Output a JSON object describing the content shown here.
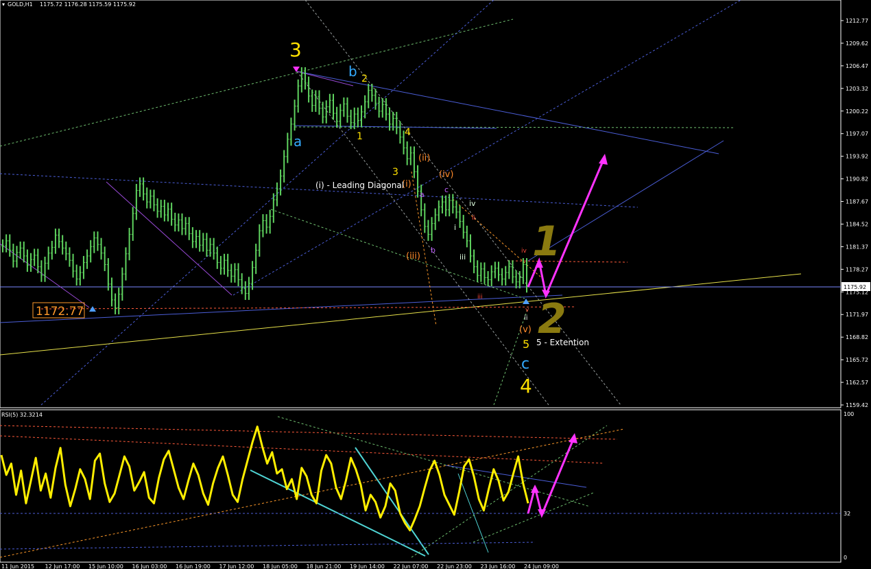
{
  "header": {
    "symbol": "GOLD,H1",
    "ohlc": "1175.72 1176.28 1175.59 1175.92"
  },
  "rsi": {
    "label": "RSI(5) 32.3214",
    "levels": [
      "100",
      "32",
      "0"
    ]
  },
  "price_axis": {
    "labels": [
      "1212.77",
      "1209.62",
      "1206.47",
      "1203.32",
      "1200.22",
      "1197.07",
      "1193.92",
      "1190.82",
      "1187.67",
      "1184.52",
      "1181.37",
      "1178.27",
      "1175.12",
      "1171.97",
      "1168.82",
      "1165.72",
      "1162.57",
      "1159.42"
    ],
    "current": "1175.92"
  },
  "time_axis": {
    "labels": [
      "11 Jun 2015",
      "12 Jun 17:00",
      "15 Jun 10:00",
      "16 Jun 03:00",
      "16 Jun 19:00",
      "17 Jun 12:00",
      "18 Jun 05:00",
      "18 Jun 21:00",
      "19 Jun 14:00",
      "22 Jun 07:00",
      "22 Jun 23:00",
      "23 Jun 16:00",
      "24 Jun 09:00"
    ]
  },
  "low_box": "1172.77",
  "annotations": {
    "wave3_major": "3",
    "wave4_major": "4",
    "wave_a": "a",
    "wave_b": "b",
    "wave_c": "c",
    "y1": "1",
    "y2": "2",
    "y3": "3",
    "y4": "4",
    "y5": "5",
    "o_i": "(i)",
    "o_ii": "(ii)",
    "o_iii": "(iii)",
    "o_iv": "(iv)",
    "o_v": "(v)",
    "leading_diagonal": "(i) - Leading Diagonal",
    "extension": "5 - Extention",
    "p_a": "a",
    "p_b": "b",
    "p_c": "c",
    "w_i": "i",
    "w_ii": "ii",
    "w_iii": "iii",
    "w_iv": "iv",
    "r_ii": "ii",
    "r_iii": "iii",
    "r_iv": "iv",
    "r_v": "v",
    "big1": "1",
    "big2": "2"
  },
  "chart_data": {
    "type": "line",
    "title": "",
    "series": [
      {
        "name": "GOLD,H1",
        "values": [
          1181.5,
          1182.2,
          1180.9,
          1179.4,
          1180.6,
          1181.2,
          1180.1,
          1178.8,
          1179.6,
          1180.2,
          1178.6,
          1177.4,
          1179.1,
          1180.5,
          1181.3,
          1183.0,
          1182.1,
          1181.2,
          1180.4,
          1179.5,
          1178.0,
          1176.9,
          1177.8,
          1179.2,
          1180.1,
          1181.4,
          1182.6,
          1181.7,
          1180.5,
          1178.9,
          1176.2,
          1174.0,
          1172.9,
          1174.8,
          1177.6,
          1180.4,
          1183.1,
          1186.0,
          1189.2,
          1190.1,
          1188.7,
          1187.6,
          1188.4,
          1187.2,
          1186.3,
          1187.0,
          1185.8,
          1186.6,
          1185.2,
          1184.4,
          1185.1,
          1183.9,
          1184.6,
          1183.2,
          1182.1,
          1182.8,
          1181.6,
          1182.4,
          1180.9,
          1181.7,
          1180.5,
          1179.2,
          1178.4,
          1179.5,
          1178.1,
          1177.3,
          1178.2,
          1176.8,
          1175.7,
          1174.9,
          1176.3,
          1178.5,
          1180.9,
          1183.6,
          1185.0,
          1184.1,
          1185.6,
          1187.9,
          1189.4,
          1191.2,
          1193.9,
          1196.3,
          1198.4,
          1200.9,
          1203.7,
          1205.4,
          1204.1,
          1202.3,
          1201.0,
          1202.2,
          1200.6,
          1199.4,
          1200.8,
          1201.7,
          1199.9,
          1198.8,
          1200.3,
          1201.2,
          1199.5,
          1198.6,
          1199.8,
          1198.9,
          1200.1,
          1201.5,
          1203.1,
          1202.4,
          1201.3,
          1200.2,
          1201.1,
          1199.8,
          1198.4,
          1199.2,
          1197.9,
          1196.6,
          1195.1,
          1193.6,
          1194.4,
          1191.8,
          1189.1,
          1186.5,
          1184.2,
          1183.1,
          1184.6,
          1185.8,
          1186.9,
          1187.6,
          1186.5,
          1187.8,
          1186.9,
          1186.2,
          1184.9,
          1183.4,
          1182.2,
          1180.1,
          1178.6,
          1177.4,
          1178.3,
          1177.1,
          1176.8,
          1177.9,
          1178.4,
          1177.5,
          1176.9,
          1177.8,
          1178.6,
          1177.2,
          1176.5,
          1177.1,
          1178.9,
          1175.92
        ]
      },
      {
        "name": "RSI(5)",
        "values": [
          72,
          58,
          66,
          44,
          61,
          38,
          54,
          70,
          47,
          59,
          42,
          63,
          77,
          51,
          36,
          48,
          62,
          55,
          41,
          68,
          73,
          52,
          39,
          45,
          58,
          71,
          64,
          47,
          53,
          60,
          42,
          38,
          56,
          69,
          75,
          62,
          49,
          41,
          54,
          66,
          58,
          45,
          37,
          52,
          63,
          71,
          58,
          44,
          39,
          55,
          68,
          81,
          92,
          78,
          66,
          74,
          59,
          62,
          48,
          55,
          41,
          63,
          57,
          44,
          38,
          61,
          72,
          66,
          49,
          41,
          54,
          70,
          62,
          51,
          33,
          44,
          39,
          28,
          36,
          52,
          47,
          31,
          24,
          19,
          27,
          36,
          49,
          61,
          68,
          58,
          44,
          37,
          30,
          46,
          64,
          69,
          57,
          41,
          33,
          48,
          62,
          54,
          40,
          46,
          59,
          71,
          52,
          38
        ]
      }
    ],
    "price_range": [
      1159.42,
      1212.77
    ],
    "rsi_range": [
      0,
      100
    ],
    "rsi_levels": [
      100,
      32,
      0
    ],
    "current_price": 1175.92,
    "low_marker": 1172.77
  }
}
